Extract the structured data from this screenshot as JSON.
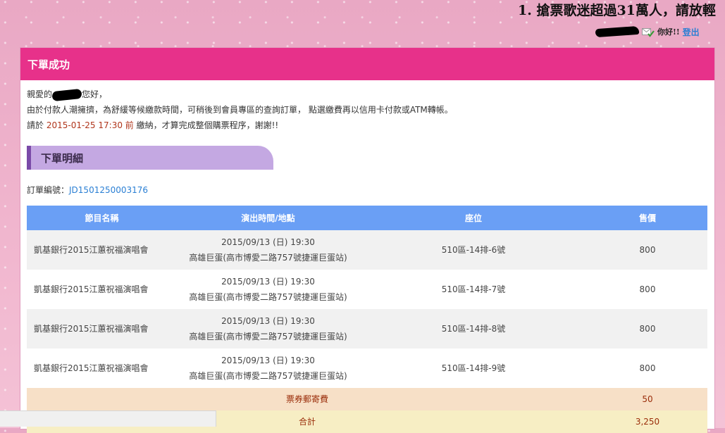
{
  "marquee": {
    "text": "1. 搶票歌迷超過31萬人，請放輕"
  },
  "userbar": {
    "greeting": "你好!!",
    "logout_label": "登出"
  },
  "panel": {
    "title": "下單成功"
  },
  "message": {
    "line1_prefix": "親愛的",
    "line1_suffix": "您好，",
    "line2": "由於付款人潮擁擠，為舒緩等候繳款時間，可稍後到會員專區的查詢訂單， 點選繳費再以信用卡付款或ATM轉帳。",
    "line3_prefix": "請於 ",
    "deadline": "2015-01-25 17:30 前",
    "line3_suffix": " 繳納，才算完成整個購票程序，謝謝!!"
  },
  "details": {
    "section_title": "下單明細",
    "order_label": "訂單編號：",
    "order_number": "JD1501250003176"
  },
  "table": {
    "headers": [
      "節目名稱",
      "演出時間/地點",
      "座位",
      "售價"
    ],
    "rows": [
      {
        "name": "凱基銀行2015江蕙祝福演唱會",
        "datetime": "2015/09/13 (日) 19:30",
        "venue": "高雄巨蛋(高市博愛二路757號捷運巨蛋站)",
        "seat": "510區-14排-6號",
        "price": "800"
      },
      {
        "name": "凱基銀行2015江蕙祝福演唱會",
        "datetime": "2015/09/13 (日) 19:30",
        "venue": "高雄巨蛋(高市博愛二路757號捷運巨蛋站)",
        "seat": "510區-14排-7號",
        "price": "800"
      },
      {
        "name": "凱基銀行2015江蕙祝福演唱會",
        "datetime": "2015/09/13 (日) 19:30",
        "venue": "高雄巨蛋(高市博愛二路757號捷運巨蛋站)",
        "seat": "510區-14排-8號",
        "price": "800"
      },
      {
        "name": "凱基銀行2015江蕙祝福演唱會",
        "datetime": "2015/09/13 (日) 19:30",
        "venue": "高雄巨蛋(高市博愛二路757號捷運巨蛋站)",
        "seat": "510區-14排-9號",
        "price": "800"
      }
    ],
    "postage_label": "票券郵寄費",
    "postage_value": "50",
    "total_label": "合計",
    "total_value": "3,250"
  },
  "icons": {
    "mail": "mail-check-icon"
  },
  "colors": {
    "header_bg": "#e7318a",
    "table_header": "#6a9ff5",
    "section_bg": "#c4a8e2",
    "link": "#2a7fd4"
  }
}
